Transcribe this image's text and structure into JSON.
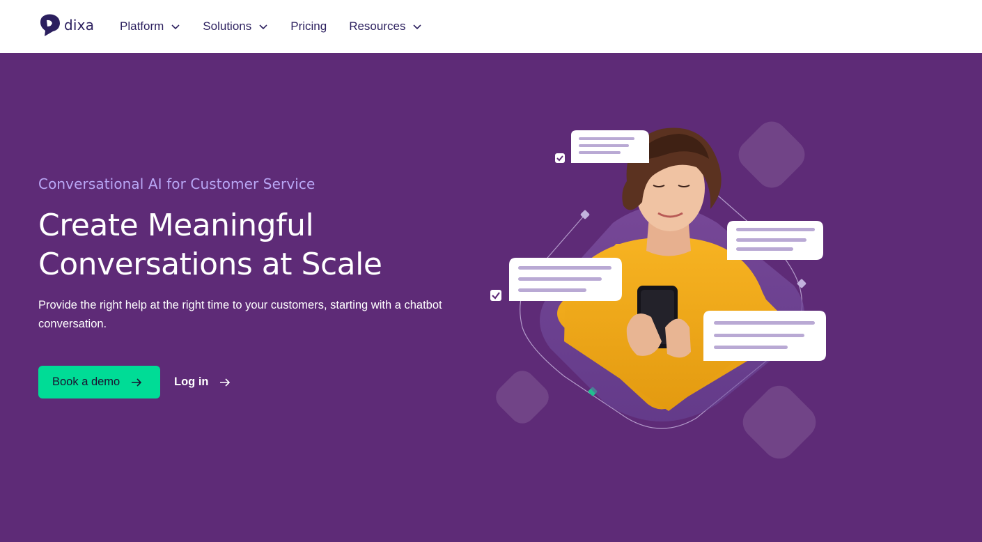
{
  "brand": {
    "name": "dixa",
    "logo_icon": "speech-pin-icon",
    "color": "#2b1f5e"
  },
  "nav": {
    "items": [
      {
        "label": "Platform",
        "has_dropdown": true
      },
      {
        "label": "Solutions",
        "has_dropdown": true
      },
      {
        "label": "Pricing",
        "has_dropdown": false
      },
      {
        "label": "Resources",
        "has_dropdown": true
      }
    ]
  },
  "hero": {
    "eyebrow": "Conversational AI for Customer Service",
    "headline_line1": "Create Meaningful",
    "headline_line2": "Conversations at Scale",
    "subtext": "Provide the right help at the right time to your customers, starting with a chatbot conversation.",
    "primary_cta": {
      "label": "Book a demo",
      "icon": "arrow-right-icon"
    },
    "secondary_cta": {
      "label": "Log in",
      "icon": "arrow-right-icon"
    }
  },
  "illustration": {
    "subject": "woman in yellow sweater smiling at smartphone",
    "chat_bubbles": 4,
    "checkmarks": 2
  },
  "colors": {
    "background": "#5e2b77",
    "accent_green": "#00dc96",
    "eyebrow_lavender": "#b9a7f5",
    "nav_text": "#2b1f5e"
  }
}
